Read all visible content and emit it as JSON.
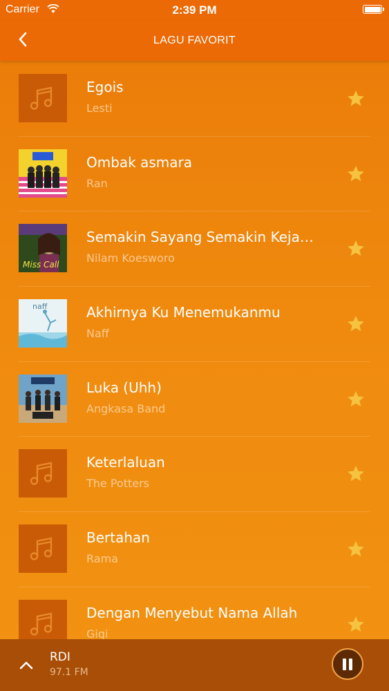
{
  "status_bar": {
    "carrier": "Carrier",
    "time": "2:39 PM"
  },
  "header": {
    "title": "LAGU FAVORIT",
    "back_icon": "chevron-left-icon"
  },
  "songs": [
    {
      "title": "Egois",
      "artist": "Lesti",
      "art": "music-note-icon",
      "favorite": true
    },
    {
      "title": "Ombak asmara",
      "artist": "Ran",
      "art": "album-cover",
      "favorite": true
    },
    {
      "title": "Semakin Sayang Semakin Kejam…",
      "artist": "Nilam Koesworo",
      "art": "album-cover",
      "cover_text": "Miss Call",
      "favorite": true
    },
    {
      "title": "Akhirnya Ku Menemukanmu",
      "artist": "Naff",
      "art": "album-cover",
      "cover_text": "naff",
      "favorite": true
    },
    {
      "title": "Luka (Uhh)",
      "artist": "Angkasa Band",
      "art": "album-cover",
      "favorite": true
    },
    {
      "title": "Keterlaluan",
      "artist": "The Potters",
      "art": "music-note-icon",
      "favorite": true
    },
    {
      "title": "Bertahan",
      "artist": "Rama",
      "art": "music-note-icon",
      "favorite": true
    },
    {
      "title": "Dengan Menyebut Nama Allah",
      "artist": "Gigi",
      "art": "music-note-icon",
      "favorite": true
    }
  ],
  "player": {
    "station": "RDI",
    "frequency": "97.1 FM",
    "state": "playing"
  },
  "colors": {
    "accent": "#ec6a05",
    "star": "#f6c341",
    "player_bar": "#a84e06"
  }
}
